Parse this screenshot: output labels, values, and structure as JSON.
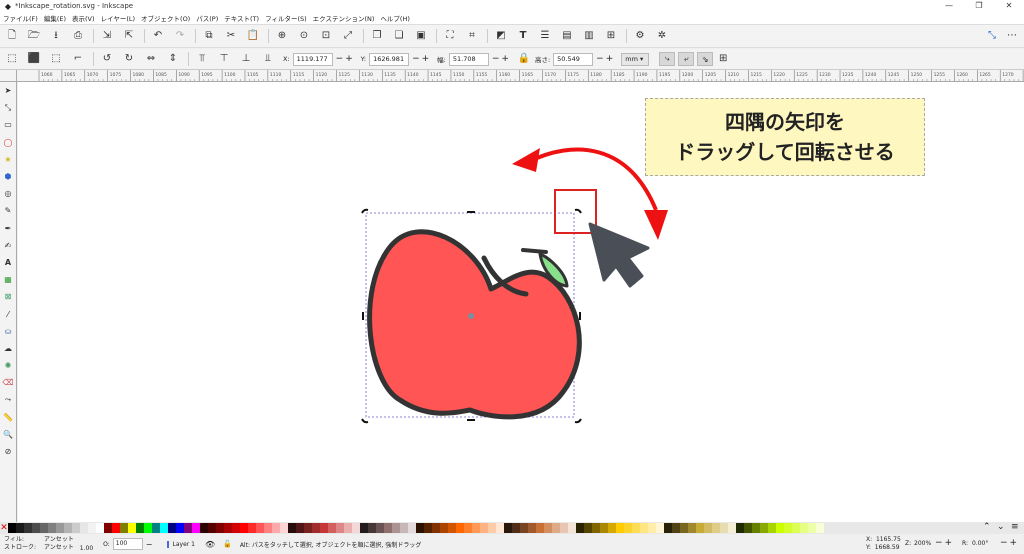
{
  "window": {
    "title": "*Inkscape_rotation.svg - Inkscape",
    "controls": [
      "—",
      "❐",
      "✕"
    ]
  },
  "menu": [
    "ファイル(F)",
    "編集(E)",
    "表示(V)",
    "レイヤー(L)",
    "オブジェクト(O)",
    "パス(P)",
    "テキスト(T)",
    "フィルター(S)",
    "エクステンション(N)",
    "ヘルプ(H)"
  ],
  "controls": {
    "x": {
      "label": "X:",
      "value": "1119.177"
    },
    "y": {
      "label": "Y:",
      "value": "1626.981"
    },
    "w": {
      "label": "幅:",
      "value": "51.708"
    },
    "h": {
      "label": "高さ:",
      "value": "50.549"
    },
    "unit": "mm ▾"
  },
  "ruler_ticks": [
    "1060",
    "1065",
    "1070",
    "1075",
    "1080",
    "1085",
    "1090",
    "1095",
    "1100",
    "1105",
    "1110",
    "1115",
    "1120",
    "1125",
    "1130",
    "1135",
    "1140",
    "1145",
    "1150",
    "1155",
    "1160",
    "1165",
    "1170",
    "1175",
    "1180",
    "1185",
    "1190",
    "1195",
    "1200",
    "1205",
    "1210",
    "1215",
    "1220",
    "1225",
    "1230",
    "1235",
    "1240",
    "1245",
    "1250",
    "1255",
    "1260",
    "1265",
    "1270",
    "1275"
  ],
  "callout": {
    "line1": "四隅の矢印を",
    "line2": "ドラッグして回転させる"
  },
  "palette": [
    "#000000",
    "#1a1a1a",
    "#333333",
    "#4d4d4d",
    "#666666",
    "#808080",
    "#999999",
    "#b3b3b3",
    "#cccccc",
    "#e6e6e6",
    "#f2f2f2",
    "#ffffff",
    "#800000",
    "#ff0000",
    "#808000",
    "#ffff00",
    "#008000",
    "#00ff00",
    "#008080",
    "#00ffff",
    "#000080",
    "#0000ff",
    "#800080",
    "#ff00ff",
    "#2b0000",
    "#550000",
    "#800000",
    "#aa0000",
    "#d40000",
    "#ff0000",
    "#ff2a2a",
    "#ff5555",
    "#ff8080",
    "#ffaaaa",
    "#ffd5d5",
    "#280b0b",
    "#501616",
    "#782121",
    "#a02c2c",
    "#c83737",
    "#d35f5f",
    "#de8787",
    "#e9afaf",
    "#f4d7d7",
    "#241c1c",
    "#483737",
    "#6c5353",
    "#916f6f",
    "#ac9393",
    "#c8b7b7",
    "#e3dbdb",
    "#2b1100",
    "#552200",
    "#803300",
    "#aa4400",
    "#d45500",
    "#ff6600",
    "#ff7f2a",
    "#ff9955",
    "#ffb380",
    "#ffccaa",
    "#ffe6d5",
    "#28170b",
    "#502d16",
    "#784421",
    "#a05a2c",
    "#c87137",
    "#d38d5f",
    "#deaa87",
    "#e9c6af",
    "#f4e3d7",
    "#2b2200",
    "#554400",
    "#806600",
    "#aa8800",
    "#d4aa00",
    "#ffcc00",
    "#ffd42a",
    "#ffdd55",
    "#ffe680",
    "#ffeeaa",
    "#fff6d5",
    "#28220b",
    "#504416",
    "#786721",
    "#a0892c",
    "#c8ab37",
    "#d3bc5f",
    "#decd87",
    "#e9ddaf",
    "#f4eed7",
    "#222b00",
    "#445500",
    "#668000",
    "#88aa00",
    "#aad400",
    "#ccff00",
    "#d4ff2a",
    "#ddff55",
    "#e5ff80",
    "#eeffaa",
    "#f6ffd5"
  ],
  "status": {
    "fill_label": "フィル:",
    "fill_value": "アンセット",
    "stroke_label": "ストローク:",
    "stroke_value": "アンセット",
    "stroke_width": "1.00",
    "opacity_label": "O:",
    "opacity_value": "100",
    "layer": "Layer 1",
    "message": "Alt: パスをタッチして選択, オブジェクトを順に選択, 強制ドラッグ",
    "cursor_x_label": "X:",
    "cursor_x": "1165.75",
    "cursor_y_label": "Y:",
    "cursor_y": "1668.59",
    "zoom_label": "Z:",
    "zoom": "200%",
    "rotate_label": "R:",
    "rotate": "0.00°"
  },
  "colors": {
    "apple_fill": "#ff5555",
    "apple_stroke": "#333333",
    "leaf": "#88e08a",
    "arrow": "#ee1111",
    "cursor": "#4a4f57",
    "highlight_box": "#dd2222",
    "callout_bg": "#fff7c0"
  }
}
